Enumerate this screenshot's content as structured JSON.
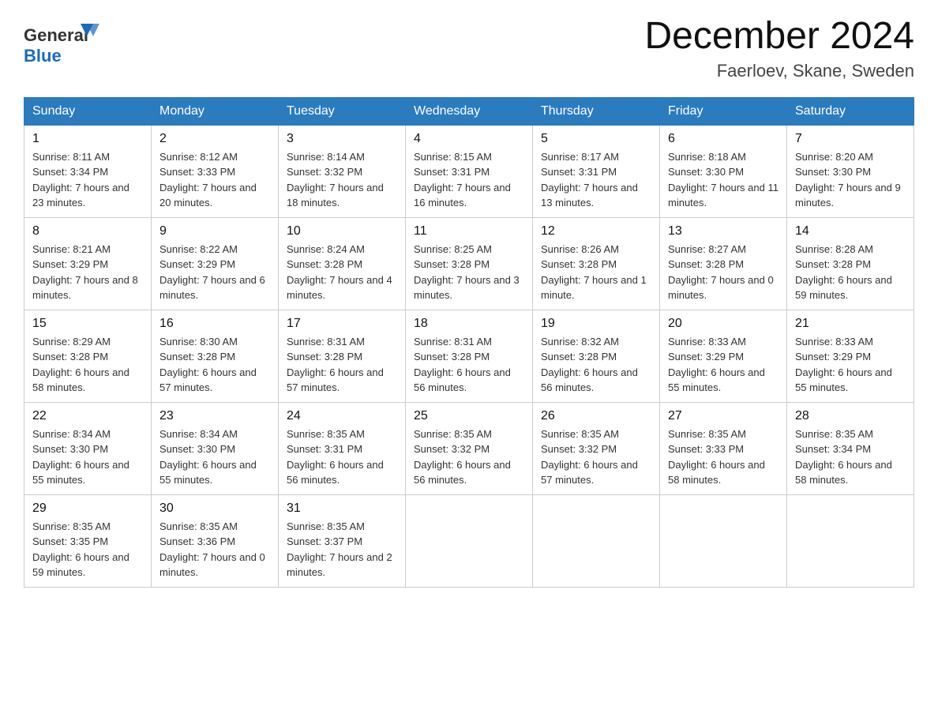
{
  "header": {
    "logo_general": "General",
    "logo_blue": "Blue",
    "month_title": "December 2024",
    "location": "Faerloev, Skane, Sweden"
  },
  "calendar": {
    "days_of_week": [
      "Sunday",
      "Monday",
      "Tuesday",
      "Wednesday",
      "Thursday",
      "Friday",
      "Saturday"
    ],
    "weeks": [
      [
        {
          "date": "1",
          "sunrise": "Sunrise: 8:11 AM",
          "sunset": "Sunset: 3:34 PM",
          "daylight": "Daylight: 7 hours and 23 minutes."
        },
        {
          "date": "2",
          "sunrise": "Sunrise: 8:12 AM",
          "sunset": "Sunset: 3:33 PM",
          "daylight": "Daylight: 7 hours and 20 minutes."
        },
        {
          "date": "3",
          "sunrise": "Sunrise: 8:14 AM",
          "sunset": "Sunset: 3:32 PM",
          "daylight": "Daylight: 7 hours and 18 minutes."
        },
        {
          "date": "4",
          "sunrise": "Sunrise: 8:15 AM",
          "sunset": "Sunset: 3:31 PM",
          "daylight": "Daylight: 7 hours and 16 minutes."
        },
        {
          "date": "5",
          "sunrise": "Sunrise: 8:17 AM",
          "sunset": "Sunset: 3:31 PM",
          "daylight": "Daylight: 7 hours and 13 minutes."
        },
        {
          "date": "6",
          "sunrise": "Sunrise: 8:18 AM",
          "sunset": "Sunset: 3:30 PM",
          "daylight": "Daylight: 7 hours and 11 minutes."
        },
        {
          "date": "7",
          "sunrise": "Sunrise: 8:20 AM",
          "sunset": "Sunset: 3:30 PM",
          "daylight": "Daylight: 7 hours and 9 minutes."
        }
      ],
      [
        {
          "date": "8",
          "sunrise": "Sunrise: 8:21 AM",
          "sunset": "Sunset: 3:29 PM",
          "daylight": "Daylight: 7 hours and 8 minutes."
        },
        {
          "date": "9",
          "sunrise": "Sunrise: 8:22 AM",
          "sunset": "Sunset: 3:29 PM",
          "daylight": "Daylight: 7 hours and 6 minutes."
        },
        {
          "date": "10",
          "sunrise": "Sunrise: 8:24 AM",
          "sunset": "Sunset: 3:28 PM",
          "daylight": "Daylight: 7 hours and 4 minutes."
        },
        {
          "date": "11",
          "sunrise": "Sunrise: 8:25 AM",
          "sunset": "Sunset: 3:28 PM",
          "daylight": "Daylight: 7 hours and 3 minutes."
        },
        {
          "date": "12",
          "sunrise": "Sunrise: 8:26 AM",
          "sunset": "Sunset: 3:28 PM",
          "daylight": "Daylight: 7 hours and 1 minute."
        },
        {
          "date": "13",
          "sunrise": "Sunrise: 8:27 AM",
          "sunset": "Sunset: 3:28 PM",
          "daylight": "Daylight: 7 hours and 0 minutes."
        },
        {
          "date": "14",
          "sunrise": "Sunrise: 8:28 AM",
          "sunset": "Sunset: 3:28 PM",
          "daylight": "Daylight: 6 hours and 59 minutes."
        }
      ],
      [
        {
          "date": "15",
          "sunrise": "Sunrise: 8:29 AM",
          "sunset": "Sunset: 3:28 PM",
          "daylight": "Daylight: 6 hours and 58 minutes."
        },
        {
          "date": "16",
          "sunrise": "Sunrise: 8:30 AM",
          "sunset": "Sunset: 3:28 PM",
          "daylight": "Daylight: 6 hours and 57 minutes."
        },
        {
          "date": "17",
          "sunrise": "Sunrise: 8:31 AM",
          "sunset": "Sunset: 3:28 PM",
          "daylight": "Daylight: 6 hours and 57 minutes."
        },
        {
          "date": "18",
          "sunrise": "Sunrise: 8:31 AM",
          "sunset": "Sunset: 3:28 PM",
          "daylight": "Daylight: 6 hours and 56 minutes."
        },
        {
          "date": "19",
          "sunrise": "Sunrise: 8:32 AM",
          "sunset": "Sunset: 3:28 PM",
          "daylight": "Daylight: 6 hours and 56 minutes."
        },
        {
          "date": "20",
          "sunrise": "Sunrise: 8:33 AM",
          "sunset": "Sunset: 3:29 PM",
          "daylight": "Daylight: 6 hours and 55 minutes."
        },
        {
          "date": "21",
          "sunrise": "Sunrise: 8:33 AM",
          "sunset": "Sunset: 3:29 PM",
          "daylight": "Daylight: 6 hours and 55 minutes."
        }
      ],
      [
        {
          "date": "22",
          "sunrise": "Sunrise: 8:34 AM",
          "sunset": "Sunset: 3:30 PM",
          "daylight": "Daylight: 6 hours and 55 minutes."
        },
        {
          "date": "23",
          "sunrise": "Sunrise: 8:34 AM",
          "sunset": "Sunset: 3:30 PM",
          "daylight": "Daylight: 6 hours and 55 minutes."
        },
        {
          "date": "24",
          "sunrise": "Sunrise: 8:35 AM",
          "sunset": "Sunset: 3:31 PM",
          "daylight": "Daylight: 6 hours and 56 minutes."
        },
        {
          "date": "25",
          "sunrise": "Sunrise: 8:35 AM",
          "sunset": "Sunset: 3:32 PM",
          "daylight": "Daylight: 6 hours and 56 minutes."
        },
        {
          "date": "26",
          "sunrise": "Sunrise: 8:35 AM",
          "sunset": "Sunset: 3:32 PM",
          "daylight": "Daylight: 6 hours and 57 minutes."
        },
        {
          "date": "27",
          "sunrise": "Sunrise: 8:35 AM",
          "sunset": "Sunset: 3:33 PM",
          "daylight": "Daylight: 6 hours and 58 minutes."
        },
        {
          "date": "28",
          "sunrise": "Sunrise: 8:35 AM",
          "sunset": "Sunset: 3:34 PM",
          "daylight": "Daylight: 6 hours and 58 minutes."
        }
      ],
      [
        {
          "date": "29",
          "sunrise": "Sunrise: 8:35 AM",
          "sunset": "Sunset: 3:35 PM",
          "daylight": "Daylight: 6 hours and 59 minutes."
        },
        {
          "date": "30",
          "sunrise": "Sunrise: 8:35 AM",
          "sunset": "Sunset: 3:36 PM",
          "daylight": "Daylight: 7 hours and 0 minutes."
        },
        {
          "date": "31",
          "sunrise": "Sunrise: 8:35 AM",
          "sunset": "Sunset: 3:37 PM",
          "daylight": "Daylight: 7 hours and 2 minutes."
        },
        null,
        null,
        null,
        null
      ]
    ]
  }
}
